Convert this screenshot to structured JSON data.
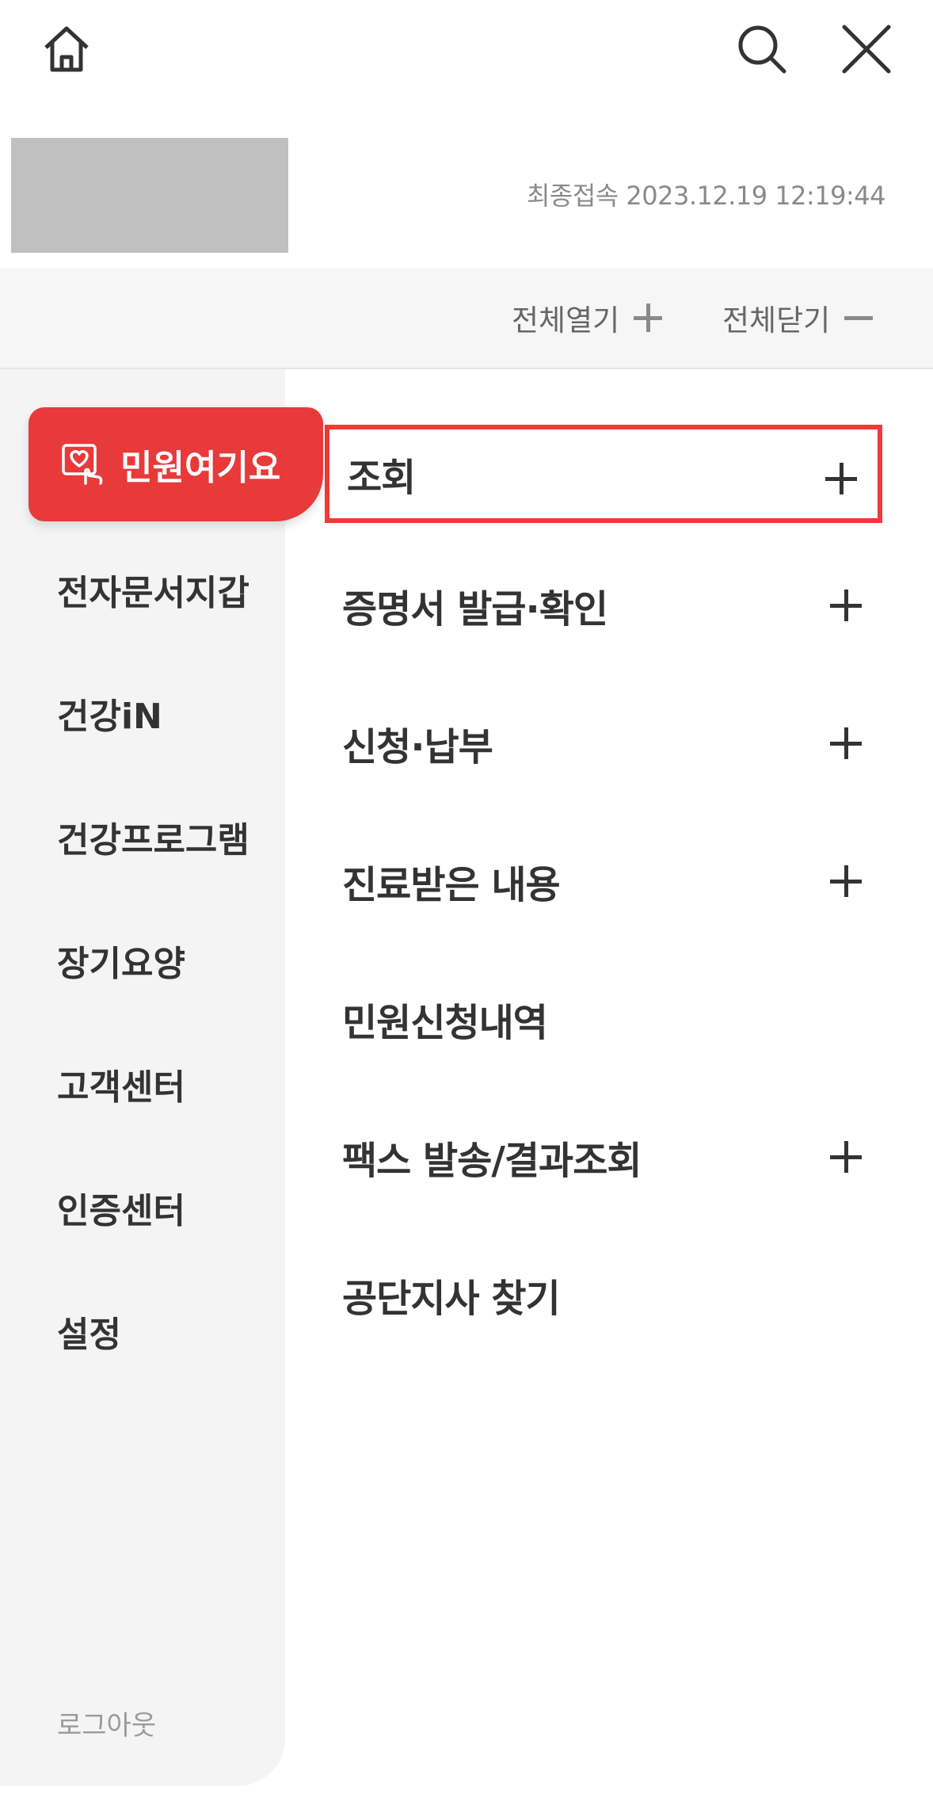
{
  "header": {
    "home_icon": "home-icon",
    "search_icon": "search-icon",
    "close_icon": "close-icon"
  },
  "profile": {
    "last_login": "최종접속 2023.12.19 12:19:44"
  },
  "toolbar": {
    "open_all": "전체열기",
    "close_all": "전체닫기"
  },
  "sidebar": {
    "active": "민원여기요",
    "items": [
      "전자문서지갑",
      "건강iN",
      "건강프로그램",
      "장기요양",
      "고객센터",
      "인증센터",
      "설정"
    ],
    "logout": "로그아웃"
  },
  "menu": {
    "items": [
      {
        "label": "조회",
        "expandable": true
      },
      {
        "label": "증명서 발급·확인",
        "expandable": true
      },
      {
        "label": "신청·납부",
        "expandable": true
      },
      {
        "label": "진료받은 내용",
        "expandable": true
      },
      {
        "label": "민원신청내역",
        "expandable": false
      },
      {
        "label": "팩스 발송/결과조회",
        "expandable": true
      },
      {
        "label": "공단지사 찾기",
        "expandable": false
      }
    ]
  },
  "colors": {
    "accent": "#e83a3a",
    "highlight_border": "#f23a3a",
    "sidebar_bg": "#f4f4f4"
  }
}
